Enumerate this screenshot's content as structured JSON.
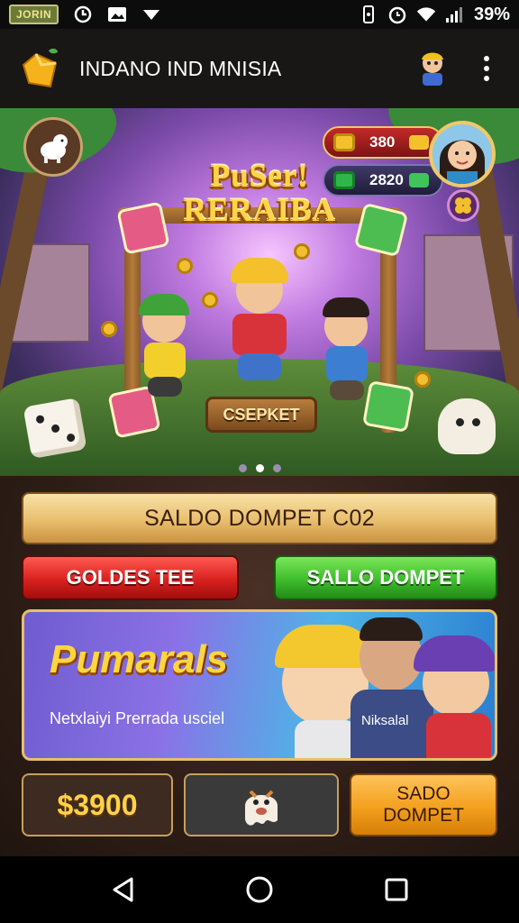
{
  "status_bar": {
    "carrier": "JORIN",
    "battery_text": "39%"
  },
  "app_bar": {
    "title": "INDANO IND MNISIA"
  },
  "hero": {
    "title_line1": "PuSer!",
    "title_line2": "RERAIBA",
    "coins_value": "380",
    "gems_value": "2820",
    "sign_label": "CSEPKET",
    "carousel_pages": 3,
    "carousel_active": 2
  },
  "panel": {
    "wallet_bar_label": "SALDO DOMPET C02",
    "red_button_label": "GOLDES TEE",
    "green_button_label": "SALLO DOMPET",
    "promo": {
      "title": "Pumarals",
      "subtitle": "Netxlaiyi Prerrada usciel",
      "name": "Niksalal"
    },
    "balance": "$3900",
    "wallet_button_line1": "SADO",
    "wallet_button_line2": "DOMPET"
  },
  "colors": {
    "accent_gold": "#ffd449",
    "button_red": "#d8211f",
    "button_green": "#3fbd2c",
    "button_orange": "#f3a01e"
  },
  "icons": [
    "alarm-icon",
    "image-icon",
    "dropdown-icon",
    "vibrate-icon",
    "clock-icon",
    "wifi-icon",
    "signal-icon",
    "back-icon",
    "home-icon",
    "recents-icon"
  ]
}
